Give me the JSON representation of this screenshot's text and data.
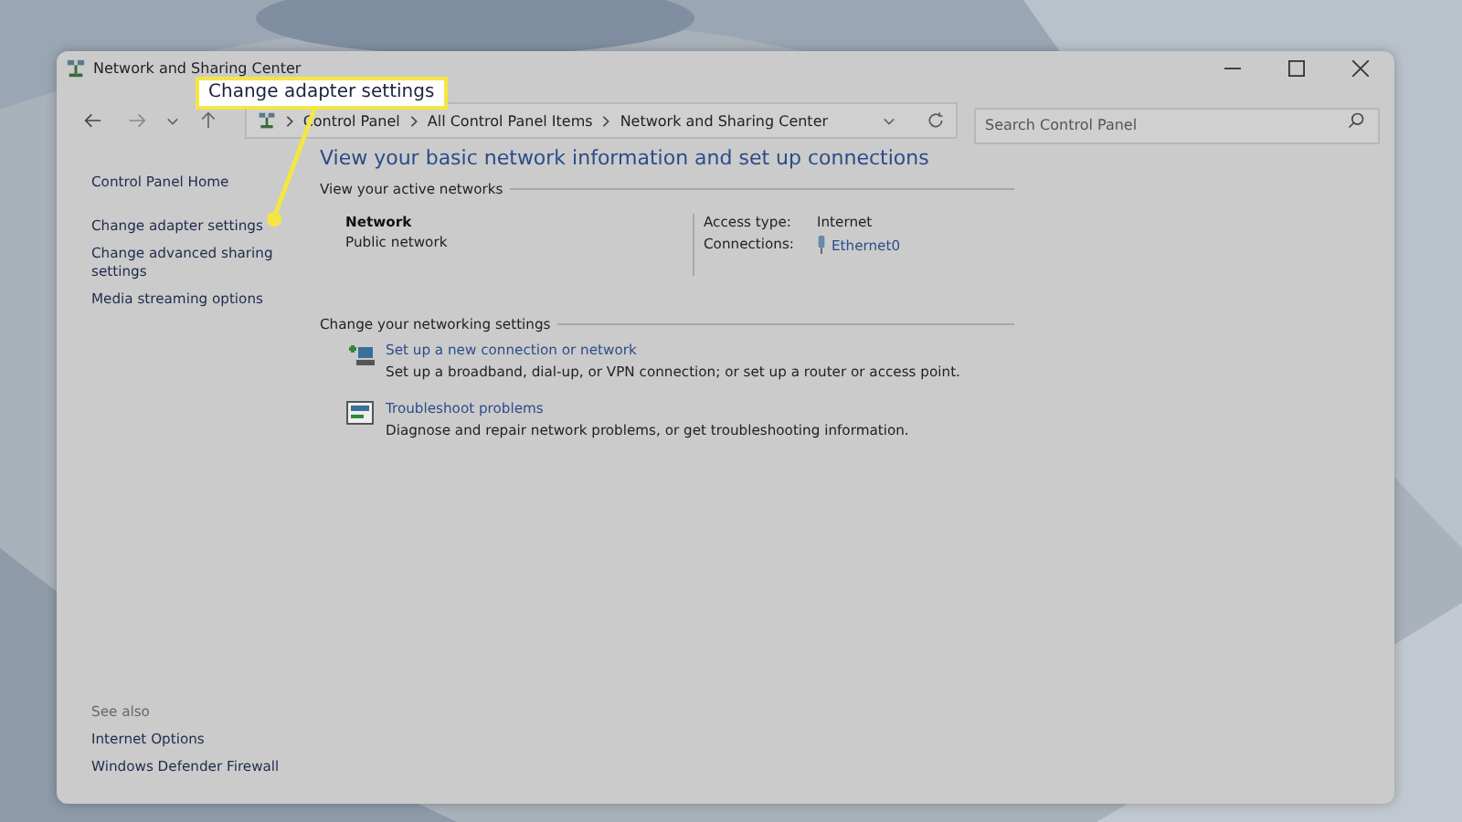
{
  "window": {
    "title": "Network and Sharing Center"
  },
  "address_bar": {
    "crumbs": [
      "Control Panel",
      "All Control Panel Items",
      "Network and Sharing Center"
    ]
  },
  "search": {
    "placeholder": "Search Control Panel"
  },
  "sidebar": {
    "items": [
      "Control Panel Home",
      "Change adapter settings",
      "Change advanced sharing settings",
      "Media streaming options"
    ],
    "see_also": {
      "heading": "See also",
      "items": [
        "Internet Options",
        "Windows Defender Firewall"
      ]
    }
  },
  "main": {
    "heading": "View your basic network information and set up connections",
    "active_networks": {
      "title": "View your active networks",
      "name": "Network",
      "type": "Public network",
      "access_label": "Access type:",
      "access_value": "Internet",
      "connections_label": "Connections:",
      "connections_value": "Ethernet0"
    },
    "settings": {
      "title": "Change your networking settings",
      "tasks": [
        {
          "kind": "new-connection",
          "title": "Set up a new connection or network",
          "description": "Set up a broadband, dial-up, or VPN connection; or set up a router or access point."
        },
        {
          "kind": "troubleshoot",
          "title": "Troubleshoot problems",
          "description": "Diagnose and repair network problems, or get troubleshooting information."
        }
      ]
    }
  },
  "callout": {
    "text": "Change adapter settings"
  }
}
